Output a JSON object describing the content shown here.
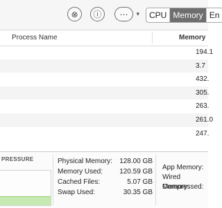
{
  "toolbar": {
    "stop_icon": "⊗",
    "info_icon": "ⓘ",
    "more_icon": "⋯",
    "more_chevron": "▾",
    "tabs": [
      "CPU",
      "Memory",
      "En"
    ],
    "active_tab": "Memory"
  },
  "table": {
    "columns": {
      "process_name": "Process Name",
      "memory": "Memory"
    },
    "rows": [
      {
        "memory": "194.1"
      },
      {
        "memory": "3.7"
      },
      {
        "memory": "432."
      },
      {
        "memory": "305."
      },
      {
        "memory": "263."
      },
      {
        "memory": "261.0"
      },
      {
        "memory": "247."
      }
    ]
  },
  "memory_pressure": {
    "label": "PRESSURE",
    "level_fraction": 0.25,
    "color": "#c6eab2"
  },
  "stats": {
    "physical_memory": {
      "label": "Physical Memory:",
      "value": "128.00 GB"
    },
    "memory_used": {
      "label": "Memory Used:",
      "value": "120.59 GB"
    },
    "cached_files": {
      "label": "Cached Files:",
      "value": "5.07 GB"
    },
    "swap_used": {
      "label": "Swap Used:",
      "value": "30.35 GB"
    }
  },
  "stats_right": {
    "app_memory": "App Memory:",
    "wired_memory": "Wired Memory:",
    "compressed": "Compressed:"
  }
}
